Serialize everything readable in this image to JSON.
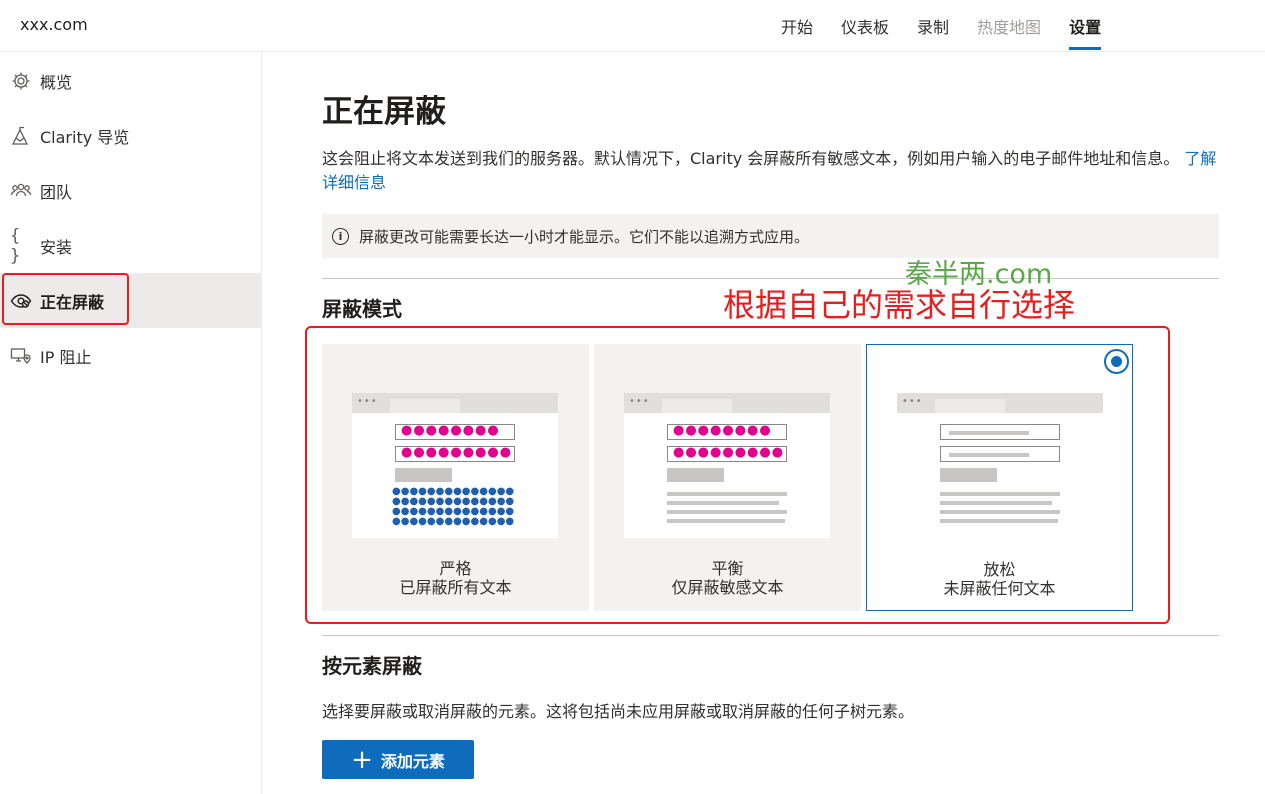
{
  "brand": "xxx.com",
  "top_nav": [
    {
      "label": "开始",
      "state": "normal"
    },
    {
      "label": "仪表板",
      "state": "normal"
    },
    {
      "label": "录制",
      "state": "normal"
    },
    {
      "label": "热度地图",
      "state": "disabled"
    },
    {
      "label": "设置",
      "state": "active"
    }
  ],
  "sidebar": {
    "items": [
      {
        "label": "概览",
        "icon": "gear-icon"
      },
      {
        "label": "Clarity 导览",
        "icon": "mountain-icon"
      },
      {
        "label": "团队",
        "icon": "people-icon"
      },
      {
        "label": "安装",
        "icon": "braces-icon"
      },
      {
        "label": "正在屏蔽",
        "icon": "eye-hidden-icon",
        "active": true
      },
      {
        "label": "IP 阻止",
        "icon": "ip-block-icon"
      }
    ]
  },
  "main": {
    "title": "正在屏蔽",
    "description": "这会阻止将文本发送到我们的服务器。默认情况下，Clarity 会屏蔽所有敏感文本，例如用户输入的电子邮件地址和信息。",
    "learn_more": "了解详细信息",
    "info_message": "屏蔽更改可能需要长达一小时才能显示。它们不能以追溯方式应用。",
    "masking_mode_title": "屏蔽模式",
    "modes": [
      {
        "title": "严格",
        "subtitle": "已屏蔽所有文本",
        "selected": false
      },
      {
        "title": "平衡",
        "subtitle": "仅屏蔽敏感文本",
        "selected": false
      },
      {
        "title": "放松",
        "subtitle": "未屏蔽任何文本",
        "selected": true
      }
    ],
    "element_section_title": "按元素屏蔽",
    "element_section_desc": "选择要屏蔽或取消屏蔽的元素。这将包括尚未应用屏蔽或取消屏蔽的任何子树元素。",
    "add_element_button": "添加元素"
  },
  "overlay": {
    "watermark": "秦半两.com",
    "annotation": "根据自己的需求自行选择"
  },
  "colors": {
    "accent": "#0f6cbd",
    "highlight_red": "#e81e1e",
    "masked_pink": "#e3008c",
    "watermark_green": "#5aa84a"
  }
}
